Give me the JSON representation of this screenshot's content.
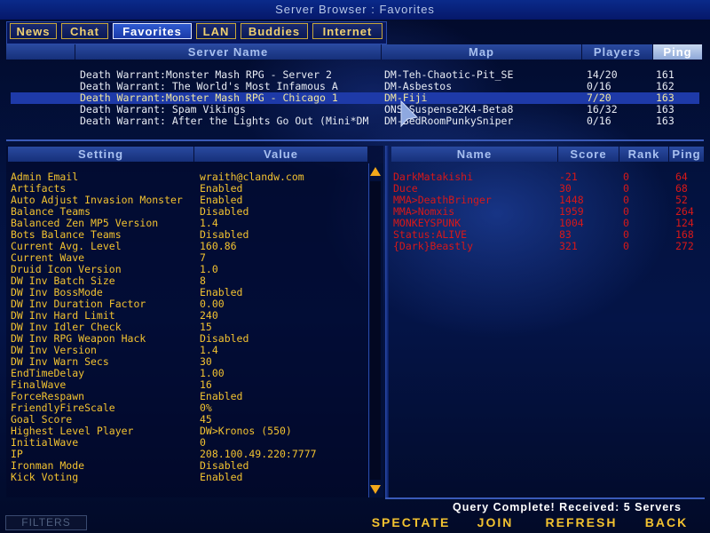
{
  "window": {
    "title": "Server Browser : Favorites"
  },
  "tabs": [
    {
      "label": "News"
    },
    {
      "label": "Chat"
    },
    {
      "label": "Favorites"
    },
    {
      "label": "LAN"
    },
    {
      "label": "Buddies"
    },
    {
      "label": "Internet"
    }
  ],
  "server_list": {
    "columns": {
      "name": "Server Name",
      "map": "Map",
      "players": "Players",
      "ping": "Ping"
    },
    "rows": [
      {
        "name": "Death Warrant:Monster Mash RPG - Server 2",
        "map": "DM-Teh-Chaotic-Pit_SE",
        "players": "14/20",
        "ping": "161"
      },
      {
        "name": "Death Warrant: The World's Most Infamous A",
        "map": "DM-Asbestos",
        "players": "0/16",
        "ping": "162"
      },
      {
        "name": "Death Warrant:Monster Mash RPG - Chicago 1",
        "map": "DM-Fiji",
        "players": "7/20",
        "ping": "163"
      },
      {
        "name": "Death Warrant: Spam Vikings",
        "map": "ONS-Suspense2K4-Beta8",
        "players": "16/32",
        "ping": "163"
      },
      {
        "name": "Death Warrant: After the Lights Go Out (Mini*DM",
        "map": "DM-BedRoomPunkySniper",
        "players": "0/16",
        "ping": "163"
      }
    ]
  },
  "settings": {
    "columns": {
      "setting": "Setting",
      "value": "Value"
    },
    "rows": [
      {
        "k": "Admin Email",
        "v": "wraith@clandw.com"
      },
      {
        "k": "Artifacts",
        "v": "Enabled"
      },
      {
        "k": "Auto Adjust Invasion Monster",
        "v": "Enabled"
      },
      {
        "k": "Balance Teams",
        "v": "Disabled"
      },
      {
        "k": "Balanced Zen MP5 Version",
        "v": "1.4"
      },
      {
        "k": "Bots Balance Teams",
        "v": "Disabled"
      },
      {
        "k": "Current Avg. Level",
        "v": "160.86"
      },
      {
        "k": "Current Wave",
        "v": "7"
      },
      {
        "k": "Druid Icon Version",
        "v": "1.0"
      },
      {
        "k": "DW Inv Batch Size",
        "v": "8"
      },
      {
        "k": "DW Inv BossMode",
        "v": "Enabled"
      },
      {
        "k": "DW Inv Duration Factor",
        "v": "0.00"
      },
      {
        "k": "DW Inv Hard Limit",
        "v": "240"
      },
      {
        "k": "DW Inv Idler Check",
        "v": "15"
      },
      {
        "k": "DW Inv RPG Weapon Hack",
        "v": "Disabled"
      },
      {
        "k": "DW Inv Version",
        "v": "1.4"
      },
      {
        "k": "DW Inv Warn Secs",
        "v": "30"
      },
      {
        "k": "EndTimeDelay",
        "v": "1.00"
      },
      {
        "k": "FinalWave",
        "v": "16"
      },
      {
        "k": "ForceRespawn",
        "v": "Enabled"
      },
      {
        "k": "FriendlyFireScale",
        "v": "0%"
      },
      {
        "k": "Goal Score",
        "v": "45"
      },
      {
        "k": "Highest Level Player",
        "v": "DW>Kronos (550)"
      },
      {
        "k": "InitialWave",
        "v": "0"
      },
      {
        "k": "IP",
        "v": "208.100.49.220:7777"
      },
      {
        "k": "Ironman Mode",
        "v": "Disabled"
      },
      {
        "k": "Kick Voting",
        "v": "Enabled"
      }
    ]
  },
  "players": {
    "columns": {
      "name": "Name",
      "score": "Score",
      "rank": "Rank",
      "ping": "Ping"
    },
    "rows": [
      {
        "name": "DarkMatakishi",
        "score": "-21",
        "rank": "0",
        "ping": "64"
      },
      {
        "name": "Duce",
        "score": "30",
        "rank": "0",
        "ping": "68"
      },
      {
        "name": "MMA>DeathBringer",
        "score": "1448",
        "rank": "0",
        "ping": "52"
      },
      {
        "name": "MMA>Nomxis",
        "score": "1959",
        "rank": "0",
        "ping": "264"
      },
      {
        "name": "MONKEYSPUNK",
        "score": "1004",
        "rank": "0",
        "ping": "124"
      },
      {
        "name": "Status:ALIVE",
        "score": "83",
        "rank": "0",
        "ping": "168"
      },
      {
        "name": "{Dark}Beastly",
        "score": "321",
        "rank": "0",
        "ping": "272"
      }
    ]
  },
  "status": {
    "text": "Query Complete! Received: 5 Servers"
  },
  "actions": {
    "filters": "FILTERS",
    "spectate": "SPECTATE",
    "join": "JOIN",
    "refresh": "REFRESH",
    "back": "BACK"
  },
  "colors": {
    "accent": "#f2c230",
    "player_text": "#d81818",
    "selected_row": "#1e3aa8"
  }
}
